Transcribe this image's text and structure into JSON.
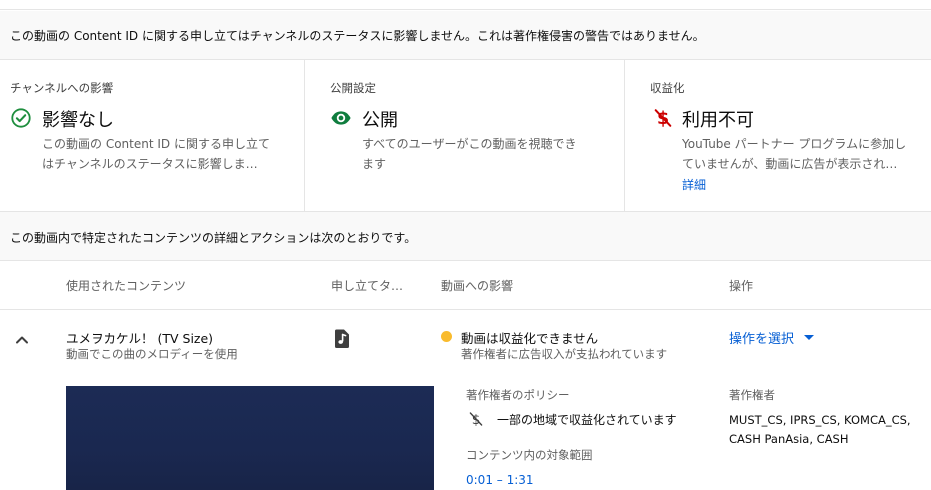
{
  "banner": {
    "text": "この動画の Content ID に関する申し立てはチャンネルのステータスに影響しません。これは著作権侵害の警告ではありません。"
  },
  "cards": {
    "channel": {
      "label": "チャンネルへの影響",
      "title": "影響なし",
      "desc_line1": "この動画の Content ID に関する申し立て",
      "desc_line2": "はチャンネルのステータスに影響しま…"
    },
    "visibility": {
      "label": "公開設定",
      "title": "公開",
      "desc_line1": "すべてのユーザーがこの動画を視聴でき",
      "desc_line2": "ます"
    },
    "monetization": {
      "label": "収益化",
      "title": "利用不可",
      "desc_line1": "YouTube パートナー プログラムに参加し",
      "desc_line2": "ていませんが、動画に広告が表示され…",
      "link": "詳細"
    }
  },
  "section": {
    "text": "この動画内で特定されたコンテンツの詳細とアクションは次のとおりです。"
  },
  "columns": {
    "content": "使用されたコンテンツ",
    "claimant": "申し立てタ…",
    "impact": "動画への影響",
    "actions": "操作"
  },
  "claim": {
    "title": "ユメヲカケル！ (TV Size)",
    "subtitle": "動画でこの曲のメロディーを使用",
    "impact": "動画は収益化できません",
    "impact_sub": "著作権者に広告収入が支払われています",
    "action_label": "操作を選択",
    "policy_label": "著作権者のポリシー",
    "policy_text": "一部の地域で収益化されています",
    "range_label": "コンテンツ内の対象範囲",
    "range_value": "0:01 – 1:31",
    "owners_label": "著作権者",
    "owners_line1": "MUST_CS, IPRS_CS, KOMCA_CS,",
    "owners_line2": "CASH PanAsia, CASH"
  },
  "colors": {
    "accent_blue": "#065fd4",
    "check_green": "#1e8e3e",
    "eye_green": "#0f7d3e",
    "no_money_red": "#cc0000",
    "warning_yellow": "#f9bb2d"
  },
  "icons": {
    "no_impact": "check-circle-icon",
    "public": "eye-icon",
    "not_monetized": "money-off-icon",
    "expand": "chevron-up-icon",
    "music": "music-note-icon",
    "policy": "money-off-icon"
  }
}
